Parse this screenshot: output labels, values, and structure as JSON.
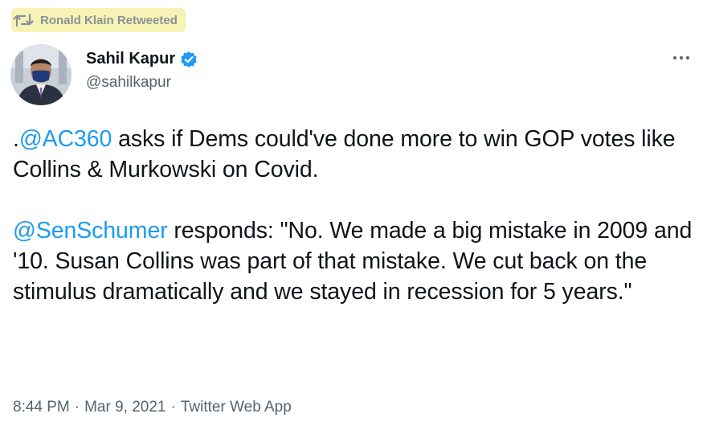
{
  "retweet": {
    "label": "Ronald Klain Retweeted",
    "icon": "retweet-icon"
  },
  "author": {
    "display_name": "Sahil Kapur",
    "handle": "@sahilkapur",
    "verified_icon": "verified-badge-icon",
    "avatar": "avatar"
  },
  "tweet": {
    "paragraph1": {
      "prefix": ".",
      "mention": "@AC360",
      "rest": " asks if Dems could've done more to win GOP votes like Collins & Murkowski on Covid."
    },
    "paragraph2": {
      "mention": "@SenSchumer",
      "rest": " responds: \"No. We made a big mistake in 2009 and '10. Susan Collins was part of that mistake. We cut back on the stimulus dramatically and we stayed in recession for 5 years.\""
    }
  },
  "meta": {
    "time": "8:44 PM",
    "separator": "·",
    "date": "Mar 9, 2021",
    "source": "Twitter Web App"
  },
  "colors": {
    "link": "#1d9bf0",
    "text": "#0f1419",
    "secondary": "#536471",
    "highlight": "#f7f3b5"
  },
  "icons": {
    "more": "more-options-icon"
  }
}
